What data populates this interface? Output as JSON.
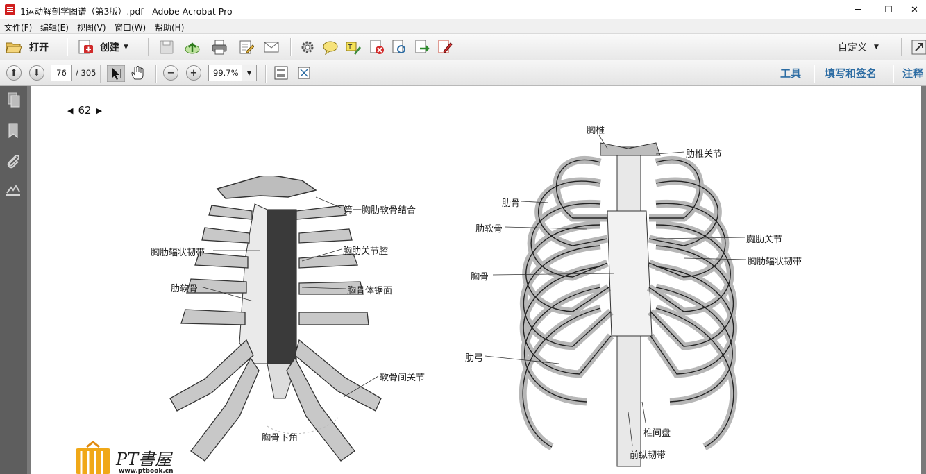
{
  "window": {
    "title": "1运动解剖学图谱（第3版）.pdf - Adobe Acrobat Pro",
    "minimize": "─",
    "maximize": "☐",
    "close": "✕"
  },
  "menu": [
    "文件(F)",
    "编辑(E)",
    "视图(V)",
    "窗口(W)",
    "帮助(H)"
  ],
  "toolbar": {
    "open_label": "打开",
    "create_label": "创建",
    "customize_label": "自定义"
  },
  "nav": {
    "current_page": "76",
    "total_pages": "/ 305",
    "zoom": "99.7%"
  },
  "right_tabs": [
    "工具",
    "填写和签名",
    "注释"
  ],
  "page": {
    "page_number": "62",
    "left_figure_labels": [
      "第一胸肋软骨结合",
      "胸肋辐状韧带",
      "胸肋关节腔",
      "肋软骨",
      "胸骨体锯面",
      "软骨间关节",
      "胸骨下角"
    ],
    "right_figure_labels": [
      "胸椎",
      "肋椎关节",
      "肋骨",
      "肋软骨",
      "胸肋关节",
      "胸肋辐状韧带",
      "胸骨",
      "肋弓",
      "椎间盘",
      "前纵韧带"
    ],
    "watermark_text": "PT書屋",
    "watermark_url": "www.ptbook.cn"
  },
  "colors": {
    "accent": "#2c6ca3",
    "pane": "#5e5e5e",
    "doc_bg": "#7a7a7a"
  }
}
